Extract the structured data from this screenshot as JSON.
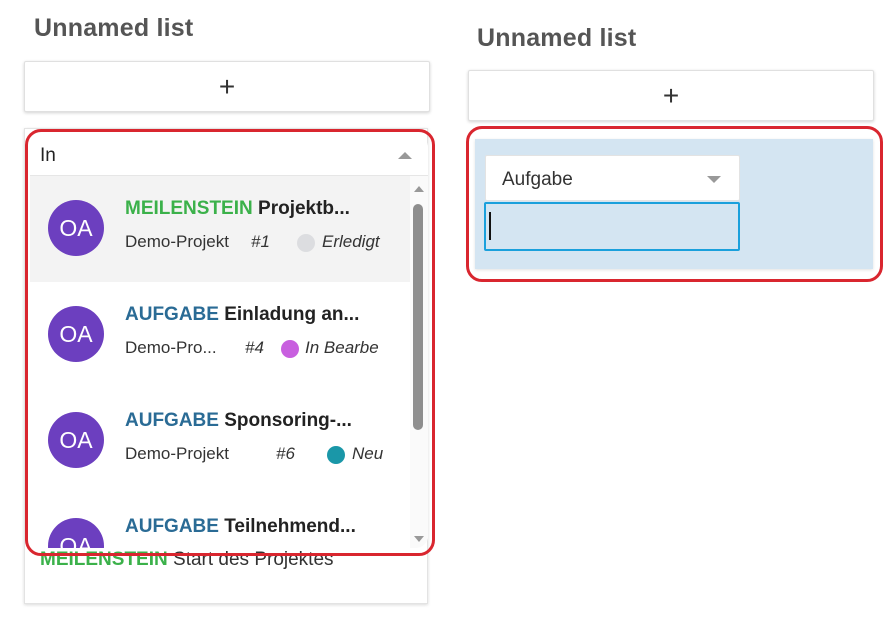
{
  "columns": [
    {
      "title": "Unnamed list",
      "add_button_label": "+",
      "combobox": {
        "input_value": "In",
        "options": [
          {
            "avatar": "OA",
            "kind": "MEILENSTEIN",
            "kind_type": "milestone",
            "title": "Projektb...",
            "project": "Demo-Projekt",
            "number": "#1",
            "status": "Erledigt",
            "status_color": "#dcdde0",
            "highlighted": true
          },
          {
            "avatar": "OA",
            "kind": "AUFGABE",
            "kind_type": "task",
            "title": "Einladung an...",
            "project": "Demo-Pro...",
            "number": "#4",
            "status": "In Bearbe",
            "status_color": "#c85fdf",
            "highlighted": false
          },
          {
            "avatar": "OA",
            "kind": "AUFGABE",
            "kind_type": "task",
            "title": "Sponsoring-...",
            "project": "Demo-Projekt",
            "number": "#6",
            "status": "Neu",
            "status_color": "#1a97a8",
            "highlighted": false
          },
          {
            "avatar": "OA",
            "kind": "AUFGABE",
            "kind_type": "task",
            "title": "Teilnehmend...",
            "project": "",
            "number": "",
            "status": "",
            "status_color": "",
            "highlighted": false
          }
        ]
      },
      "underlying_card": {
        "kind": "MEILENSTEIN",
        "title": "Start des Projektes"
      }
    },
    {
      "title": "Unnamed list",
      "add_button_label": "+",
      "new_card": {
        "type_select_value": "Aufgabe",
        "title_input_value": ""
      }
    }
  ],
  "colors": {
    "milestone": "#3bb14a",
    "task": "#2a6b95",
    "avatar": "#6c3fbf",
    "highlight_ring": "#d9262f",
    "new_card_bg": "#d4e5f2",
    "focus_border": "#1aa0dc"
  }
}
